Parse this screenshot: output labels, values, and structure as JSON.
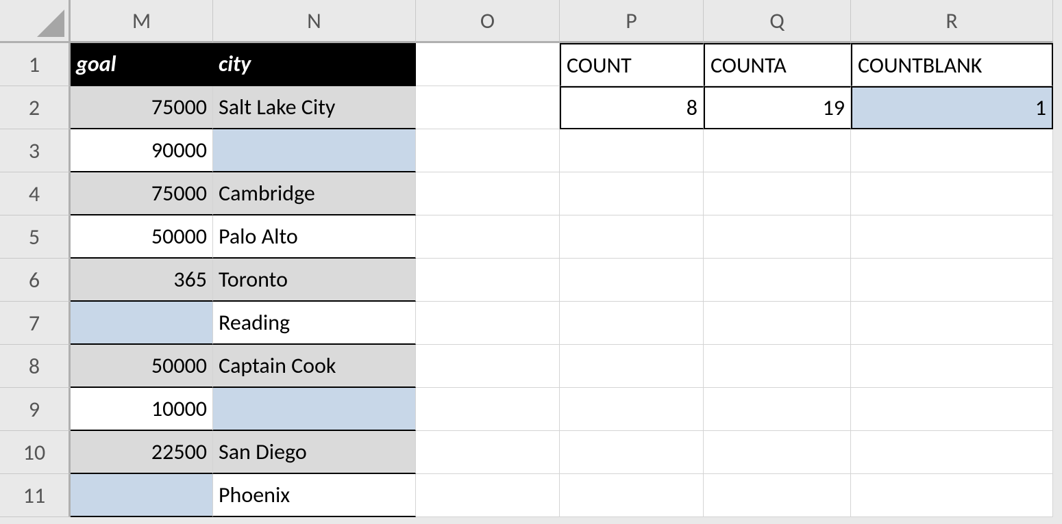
{
  "columns": [
    "M",
    "N",
    "O",
    "P",
    "Q",
    "R"
  ],
  "rows": [
    "1",
    "2",
    "3",
    "4",
    "5",
    "6",
    "7",
    "8",
    "9",
    "10",
    "11"
  ],
  "table": {
    "headers": {
      "goal": "goal",
      "city": "city"
    },
    "data": [
      {
        "goal": "75000",
        "city": "Salt Lake City"
      },
      {
        "goal": "90000",
        "city": ""
      },
      {
        "goal": "75000",
        "city": "Cambridge"
      },
      {
        "goal": "50000",
        "city": "Palo Alto"
      },
      {
        "goal": "365",
        "city": "Toronto"
      },
      {
        "goal": "",
        "city": "Reading"
      },
      {
        "goal": "50000",
        "city": "Captain Cook"
      },
      {
        "goal": "10000",
        "city": ""
      },
      {
        "goal": "22500",
        "city": "San Diego"
      },
      {
        "goal": "",
        "city": "Phoenix"
      }
    ]
  },
  "summary": {
    "headers": {
      "p": "COUNT",
      "q": "COUNTA",
      "r": "COUNTBLANK"
    },
    "values": {
      "p": "8",
      "q": "19",
      "r": "1"
    }
  }
}
